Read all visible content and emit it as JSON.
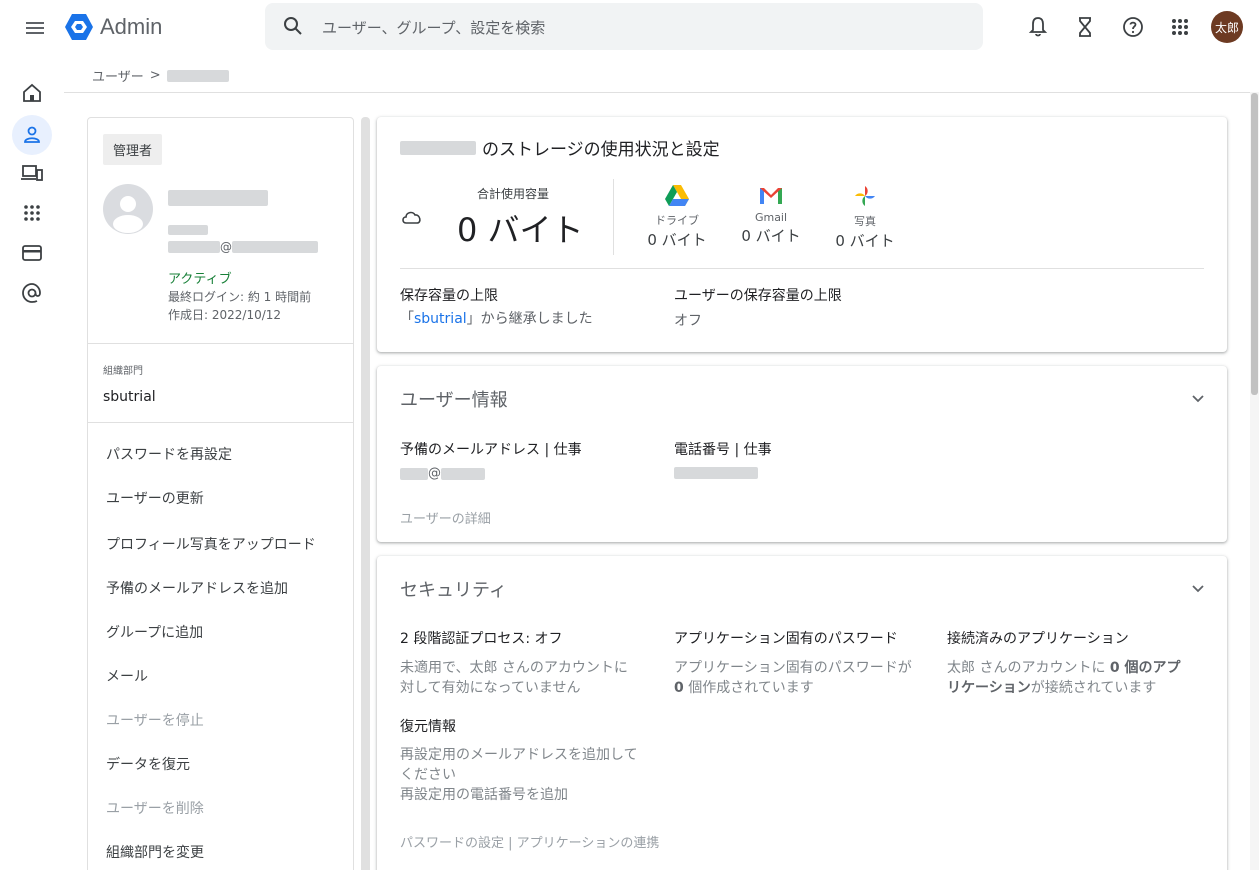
{
  "app": {
    "title": "Admin"
  },
  "search": {
    "placeholder": "ユーザー、グループ、設定を検索"
  },
  "user_avatar": {
    "initials": "太郎"
  },
  "breadcrumb": {
    "root": "ユーザー",
    "separator": ">"
  },
  "profile": {
    "role_chip": "管理者",
    "email_at": "@",
    "status": "アクティブ",
    "last_login": "最終ログイン: 約 1 時間前",
    "created": "作成日: 2022/10/12",
    "org_label": "組織部門",
    "org_value": "sbutrial"
  },
  "actions": [
    {
      "label": "パスワードを再設定",
      "enabled": true
    },
    {
      "label": "ユーザーの更新",
      "enabled": true
    },
    {
      "label": "プロフィール写真をアップロード",
      "enabled": true
    },
    {
      "label": "予備のメールアドレスを追加",
      "enabled": true
    },
    {
      "label": "グループに追加",
      "enabled": true
    },
    {
      "label": "メール",
      "enabled": true
    },
    {
      "label": "ユーザーを停止",
      "enabled": false
    },
    {
      "label": "データを復元",
      "enabled": true
    },
    {
      "label": "ユーザーを削除",
      "enabled": false
    },
    {
      "label": "組織部門を変更",
      "enabled": true
    }
  ],
  "storage": {
    "title_suffix": "のストレージの使用状況と設定",
    "total_label": "合計使用容量",
    "total_value": "0 バイト",
    "apps": [
      {
        "name": "ドライブ",
        "value": "0 バイト",
        "icon": "drive-icon"
      },
      {
        "name": "Gmail",
        "value": "0 バイト",
        "icon": "gmail-icon"
      },
      {
        "name": "写真",
        "value": "0 バイト",
        "icon": "photos-icon"
      }
    ],
    "limit_label": "保存容量の上限",
    "limit_value_prefix": "「",
    "limit_value_link": "sbutrial",
    "limit_value_suffix": "」から継承しました",
    "user_limit_label": "ユーザーの保存容量の上限",
    "user_limit_value": "オフ"
  },
  "user_info": {
    "title": "ユーザー情報",
    "alt_email_label": "予備のメールアドレス | 仕事",
    "alt_email_at": "@",
    "phone_label": "電話番号 | 仕事",
    "details_link": "ユーザーの詳細"
  },
  "security": {
    "title": "セキュリティ",
    "twostep_label": "2 段階認証プロセス: オフ",
    "twostep_desc_1": "未適用で、太郎 さんのアカウントに",
    "twostep_desc_2": "対して有効になっていません",
    "apppw_label": "アプリケーション固有のパスワード",
    "apppw_desc_1": "アプリケーション固有のパスワードが",
    "apppw_desc_2_bold": "0",
    "apppw_desc_2": " 個作成されています",
    "connected_label": "接続済みのアプリケーション",
    "connected_desc_1": "太郎 さんのアカウントに ",
    "connected_desc_1_bold": "0 個のアプ",
    "connected_desc_2_bold": "リケーション",
    "connected_desc_2": "が接続されています",
    "recovery_label": "復元情報",
    "recovery_desc_1": "再設定用のメールアドレスを追加して",
    "recovery_desc_2": "ください",
    "recovery_desc_3": "再設定用の電話番号を追加",
    "footer_links": "パスワードの設定 | アプリケーションの連携"
  }
}
